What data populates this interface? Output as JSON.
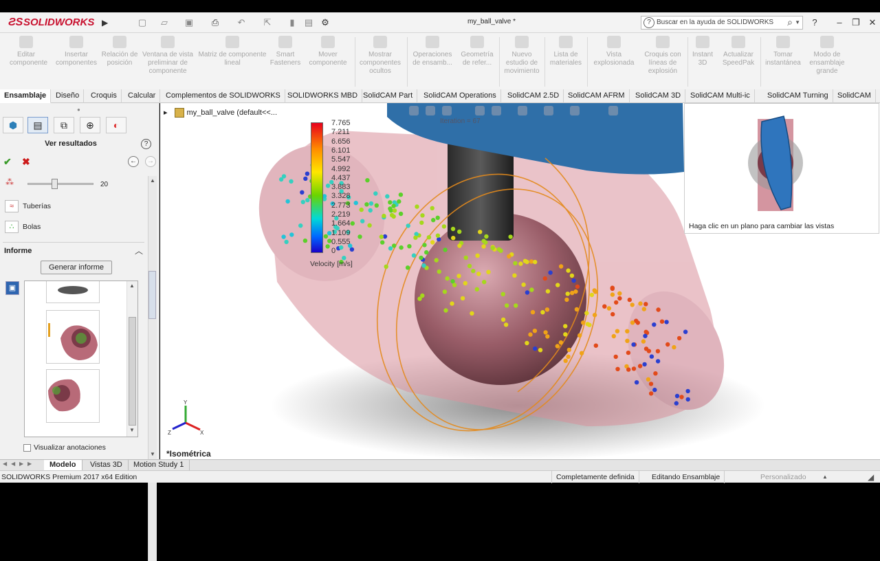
{
  "app": {
    "logo_text": "SOLIDWORKS",
    "doc_title": "my_ball_valve *",
    "help_search_placeholder": "Buscar en la ayuda de SOLIDWORKS"
  },
  "command_manager": [
    "Editar componente",
    "Insertar componentes",
    "Relación de posición",
    "Ventana de vista preliminar de componente",
    "Matriz de componente lineal",
    "Smart Fasteners",
    "Mover componente",
    "Mostrar componentes ocultos",
    "Operaciones de ensamb...",
    "Geometría de refer...",
    "Nuevo estudio de movimiento",
    "Lista de materiales",
    "Vista explosionada",
    "Croquis con líneas de explosión",
    "Instant 3D",
    "Actualizar SpeedPak",
    "Tomar instantánea",
    "Modo de ensamblaje grande"
  ],
  "tabs": [
    "Ensamblaje",
    "Diseño",
    "Croquis",
    "Calcular",
    "Complementos de SOLIDWORKS",
    "SOLIDWORKS MBD",
    "SolidCAM Part",
    "SolidCAM Operations",
    "SolidCAM 2.5D",
    "SolidCAM AFRM",
    "SolidCAM 3D",
    "SolidCAM Multi-ic",
    "SolidCAM Turning",
    "SolidCAM"
  ],
  "property_manager": {
    "title": "Ver resultados",
    "slider_value": "20",
    "slider_level_fraction": 0.4,
    "option_tuberias": "Tuberías",
    "option_bolas": "Bolas",
    "informe_header": "Informe",
    "generate_report": "Generar informe",
    "show_annotations": "Visualizar anotaciones"
  },
  "viewport": {
    "tree_item": "my_ball_valve  (default<<...",
    "iteration": "Iteration = 67",
    "legend_title": "Velocity [m/s]",
    "legend_values": [
      "7.765",
      "7.211",
      "6.656",
      "6.101",
      "5.547",
      "4.992",
      "4.437",
      "3.883",
      "3.328",
      "2.773",
      "2.219",
      "1.664",
      "1.109",
      "0.555",
      "0"
    ],
    "view_label": "*Isométrica",
    "planes_hint": "Haga clic en un plano para cambiar las vistas"
  },
  "bottom_tabs": [
    "Modelo",
    "Vistas 3D",
    "Motion Study 1"
  ],
  "status": {
    "edition": "SOLIDWORKS Premium 2017 x64 Edition",
    "definition": "Completamente definida",
    "mode": "Editando Ensamblaje",
    "custom": "Personalizado"
  }
}
